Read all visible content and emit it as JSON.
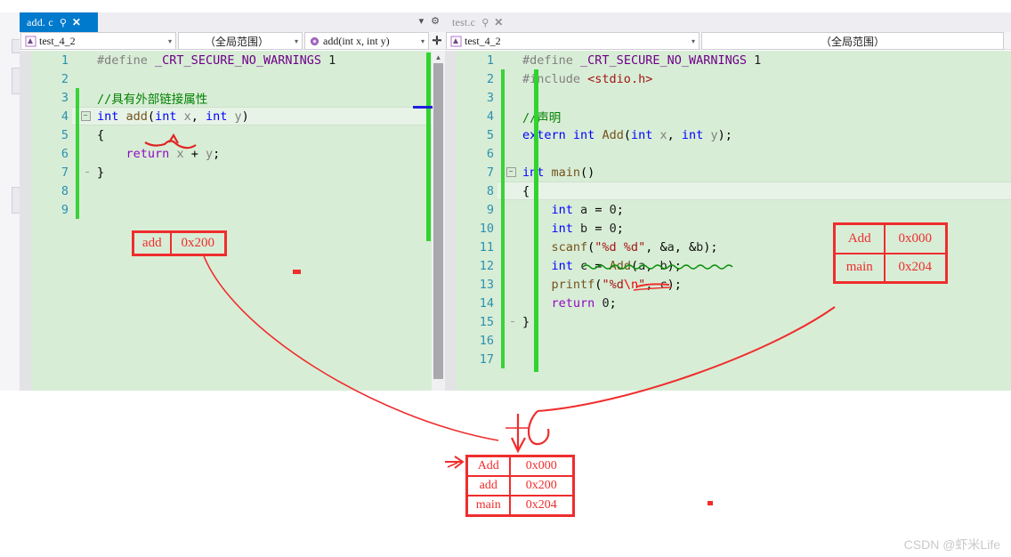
{
  "window": {
    "watermark": "CSDN @虾米Life"
  },
  "left_pane": {
    "tab": {
      "title": "add. c",
      "pin_icon": "pin-icon",
      "close_icon": "close-icon"
    },
    "tab_right_icons": {
      "dropdown_icon": "chevron-down-icon",
      "settings_icon": "gear-icon"
    },
    "nav": {
      "project": "test_4_2",
      "scope": "（全局范围）",
      "member": "add(int x, int y)",
      "project_icon": "project-icon",
      "member_icon": "method-icon",
      "split_icon": "split-view-icon",
      "arrow": "▾"
    },
    "code": [
      {
        "n": "1",
        "changed": false,
        "fold": "none",
        "html": "<span class='pp'>#define</span> <span class='mac'>_CRT_SECURE_NO_WARNINGS</span> <span class='num'>1</span>"
      },
      {
        "n": "2",
        "changed": false,
        "fold": "none",
        "html": ""
      },
      {
        "n": "3",
        "changed": true,
        "fold": "none",
        "html": "<span class='cm'>//具有外部链接属性</span>"
      },
      {
        "n": "4",
        "changed": true,
        "fold": "open",
        "html": "<span class='k'>int</span> <span class='fn'>add</span>(<span class='k'>int</span> <span class='var'>x</span>, <span class='k'>int</span> <span class='var'>y</span>)"
      },
      {
        "n": "5",
        "changed": true,
        "fold": "bar",
        "html": "{"
      },
      {
        "n": "6",
        "changed": true,
        "fold": "bar",
        "html": "    <span class='kv'>return</span> <span class='var'>x</span> + <span class='var'>y</span>;"
      },
      {
        "n": "7",
        "changed": true,
        "fold": "end",
        "html": "}"
      },
      {
        "n": "8",
        "changed": true,
        "fold": "none",
        "html": ""
      },
      {
        "n": "9",
        "changed": true,
        "fold": "none",
        "html": ""
      }
    ]
  },
  "right_pane": {
    "tab": {
      "title": "test.c",
      "pin_icon": "pin-icon",
      "close_icon": "close-icon"
    },
    "nav": {
      "project": "test_4_2",
      "scope": "（全局范围）",
      "project_icon": "project-icon",
      "arrow": "▾"
    },
    "code": [
      {
        "n": "1",
        "changed": false,
        "fold": "none",
        "html": "<span class='pp'>#define</span> <span class='mac'>_CRT_SECURE_NO_WARNINGS</span> <span class='num'>1</span>"
      },
      {
        "n": "2",
        "changed": true,
        "fold": "none",
        "html": "<span class='pp'>#include</span> <span class='inc'>&lt;stdio.h&gt;</span>"
      },
      {
        "n": "3",
        "changed": true,
        "fold": "none",
        "html": ""
      },
      {
        "n": "4",
        "changed": true,
        "fold": "none",
        "html": "<span class='cm'>//声明</span>"
      },
      {
        "n": "5",
        "changed": true,
        "fold": "none",
        "html": "<span class='k'>extern</span> <span class='k'>int</span> <span class='fn'>Add</span>(<span class='k'>int</span> <span class='var'>x</span>, <span class='k'>int</span> <span class='var'>y</span>);"
      },
      {
        "n": "6",
        "changed": true,
        "fold": "none",
        "html": ""
      },
      {
        "n": "7",
        "changed": true,
        "fold": "open",
        "html": "<span class='k'>int</span> <span class='fn'>main</span>()"
      },
      {
        "n": "8",
        "changed": true,
        "fold": "bar",
        "html": "{"
      },
      {
        "n": "9",
        "changed": true,
        "fold": "bar",
        "html": "    <span class='k'>int</span> <span class='id'>a</span> = <span class='num'>0</span>;"
      },
      {
        "n": "10",
        "changed": true,
        "fold": "bar",
        "html": "    <span class='k'>int</span> <span class='id'>b</span> = <span class='num'>0</span>;"
      },
      {
        "n": "11",
        "changed": true,
        "fold": "bar",
        "html": "    <span class='fn'>scanf</span>(<span class='str'>\"%d %d\"</span>, &amp;<span class='id'>a</span>, &amp;<span class='id'>b</span>);"
      },
      {
        "n": "12",
        "changed": true,
        "fold": "bar",
        "html": "    <span class='k'>int</span> <span class='id'>c</span> = <span class='fn'>Add</span>(<span class='id'>a</span>, <span class='id'>b</span>);"
      },
      {
        "n": "13",
        "changed": true,
        "fold": "bar",
        "html": "    <span class='fn'>printf</span>(<span class='str'>\"%d</span><span class='esc'>\\n</span><span class='str'>\"</span>, <span class='id'>c</span>);"
      },
      {
        "n": "14",
        "changed": true,
        "fold": "bar",
        "html": "    <span class='kv'>return</span> <span class='num'>0</span>;"
      },
      {
        "n": "15",
        "changed": true,
        "fold": "end",
        "html": "}"
      },
      {
        "n": "16",
        "changed": true,
        "fold": "none",
        "html": ""
      },
      {
        "n": "17",
        "changed": true,
        "fold": "none",
        "html": ""
      }
    ]
  },
  "annotations": {
    "color": "#ef2d2d",
    "table_add": {
      "rows": [
        {
          "name": "add",
          "addr": "0x200"
        }
      ]
    },
    "table_right": {
      "rows": [
        {
          "name": "Add",
          "addr": "0x000"
        },
        {
          "name": "main",
          "addr": "0x204"
        }
      ]
    },
    "table_bottom": {
      "rows": [
        {
          "name": "Add",
          "addr": "0x000"
        },
        {
          "name": "add",
          "addr": "0x200"
        },
        {
          "name": "main",
          "addr": "0x204"
        }
      ]
    }
  }
}
